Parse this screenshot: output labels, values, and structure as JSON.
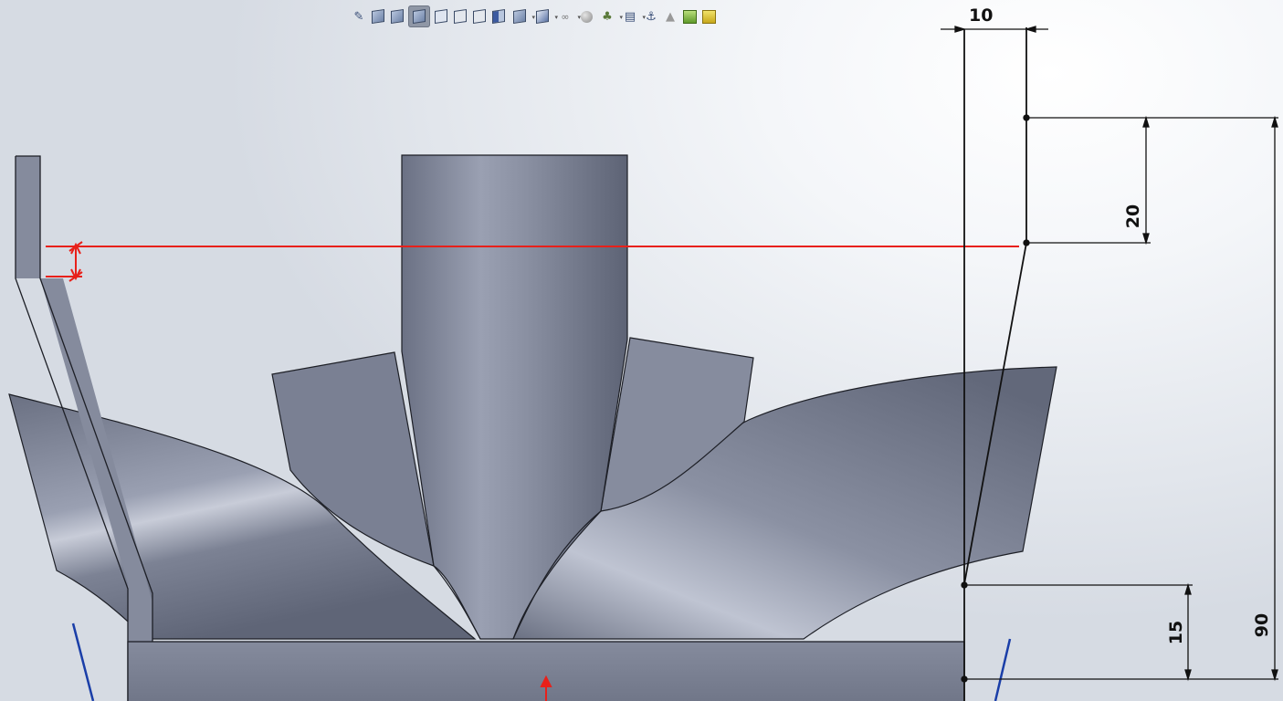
{
  "toolbar": {
    "items": [
      {
        "icon": "zoom-to-fit-icon"
      },
      {
        "icon": "shaded-with-edges-icon"
      },
      {
        "icon": "shaded-icon"
      },
      {
        "icon": "hidden-lines-removed-icon",
        "active": true
      },
      {
        "icon": "hidden-lines-visible-icon"
      },
      {
        "icon": "wireframe-icon"
      },
      {
        "icon": "draft-quality-icon"
      },
      {
        "icon": "section-view-icon"
      },
      {
        "icon": "view-orientation-icon",
        "dropdown": true
      },
      {
        "icon": "display-style-icon",
        "dropdown": true
      },
      {
        "icon": "hide-show-items-icon",
        "dropdown": true
      },
      {
        "icon": "edit-appearance-icon"
      },
      {
        "icon": "apply-scene-icon",
        "dropdown": true
      },
      {
        "icon": "view-settings-icon",
        "dropdown": true
      },
      {
        "icon": "anchor-icon"
      },
      {
        "icon": "render-tools-icon"
      },
      {
        "icon": "green-tool-icon"
      },
      {
        "icon": "yellow-tool-icon"
      }
    ]
  },
  "dimensions": {
    "horizontal_top": "10",
    "vertical_upper": "20",
    "vertical_lower": "15",
    "vertical_overall": "90"
  },
  "colors": {
    "part": "#7f8597",
    "sketch_line": "#111111",
    "highlight_line": "#e8201a",
    "axis_line": "#1a3ea8"
  }
}
